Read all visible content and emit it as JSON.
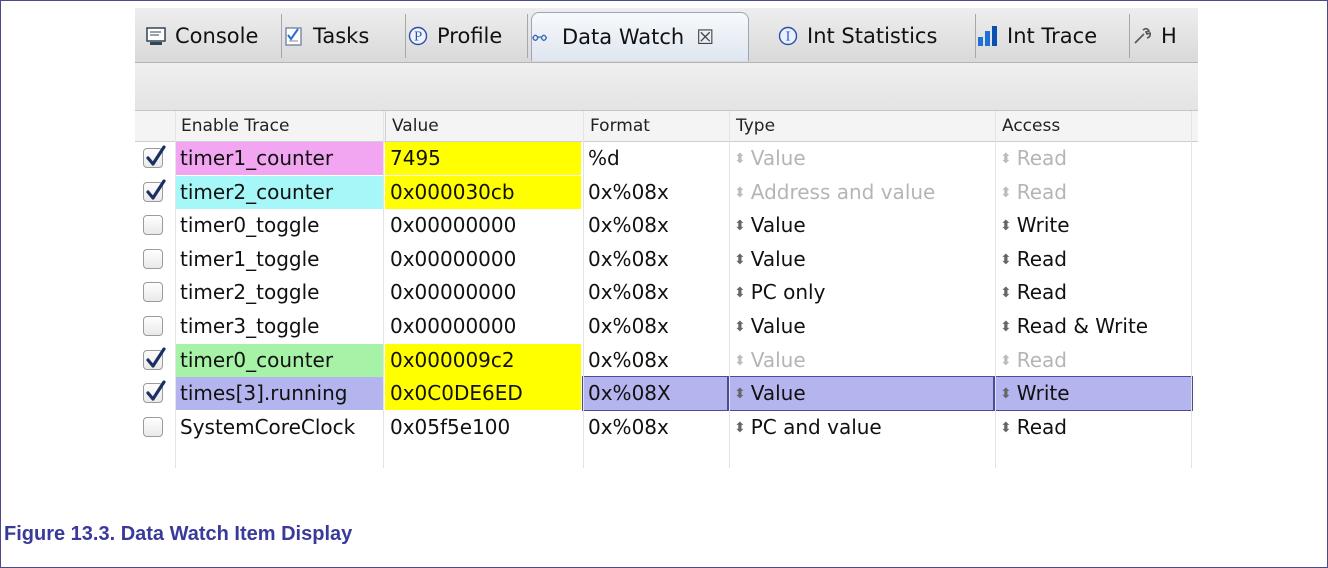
{
  "tabs": [
    {
      "label": "Console",
      "icon": "console-icon"
    },
    {
      "label": "Tasks",
      "icon": "tasks-icon"
    },
    {
      "label": "Profile",
      "icon": "profile-icon"
    },
    {
      "label": "Data Watch",
      "icon": "glasses-icon",
      "active": true,
      "close": "☒"
    },
    {
      "label": "Int Statistics",
      "icon": "info-icon"
    },
    {
      "label": "Int Trace",
      "icon": "bar-chart-icon"
    },
    {
      "label": "H",
      "icon": "wrench-icon"
    }
  ],
  "table": {
    "headers": [
      "Enable Trace",
      "Value",
      "Format",
      "Type",
      "Access"
    ],
    "rows": [
      {
        "checked": true,
        "name": "timer1_counter",
        "name_color": "#f2a6f2",
        "value": "7495",
        "value_color": "#ffff00",
        "format": "%d",
        "type": "Value",
        "access": "Read",
        "dim": true
      },
      {
        "checked": true,
        "name": "timer2_counter",
        "name_color": "#a6f7f7",
        "value": "0x000030cb",
        "value_color": "#ffff00",
        "format": "0x%08x",
        "type": "Address and value",
        "access": "Read",
        "dim": true
      },
      {
        "checked": false,
        "name": "timer0_toggle",
        "name_color": "",
        "value": "0x00000000",
        "value_color": "",
        "format": "0x%08x",
        "type": "Value",
        "access": "Write",
        "dim": false
      },
      {
        "checked": false,
        "name": "timer1_toggle",
        "name_color": "",
        "value": "0x00000000",
        "value_color": "",
        "format": "0x%08x",
        "type": "Value",
        "access": "Read",
        "dim": false
      },
      {
        "checked": false,
        "name": "timer2_toggle",
        "name_color": "",
        "value": "0x00000000",
        "value_color": "",
        "format": "0x%08x",
        "type": "PC only",
        "access": "Read",
        "dim": false
      },
      {
        "checked": false,
        "name": "timer3_toggle",
        "name_color": "",
        "value": "0x00000000",
        "value_color": "",
        "format": "0x%08x",
        "type": "Value",
        "access": "Read & Write",
        "dim": false
      },
      {
        "checked": true,
        "name": "timer0_counter",
        "name_color": "#a6f2a6",
        "value": "0x000009c2",
        "value_color": "#ffff00",
        "format": "0x%08x",
        "type": "Value",
        "access": "Read",
        "dim": true
      },
      {
        "checked": true,
        "name": "times[3].running",
        "name_color": "#b4b4ef",
        "value": "0x0C0DE6ED",
        "value_color": "#ffff00",
        "format": "0x%08X",
        "type": "Value",
        "access": "Write",
        "dim": false,
        "selected": true
      },
      {
        "checked": false,
        "name": "SystemCoreClock",
        "name_color": "",
        "value": "0x05f5e100",
        "value_color": "",
        "format": "0x%08x",
        "type": "PC and value",
        "access": "Read",
        "dim": false
      }
    ]
  },
  "caption": "Figure 13.3. Data Watch Item Display"
}
